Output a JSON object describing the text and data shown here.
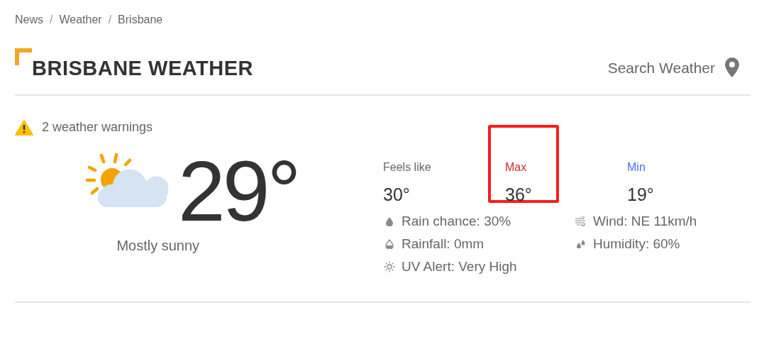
{
  "breadcrumb": [
    {
      "kind": "link",
      "text": "News"
    },
    {
      "kind": "separator",
      "text": "/"
    },
    {
      "kind": "link",
      "text": "Weather"
    },
    {
      "kind": "separator",
      "text": "/"
    },
    {
      "kind": "link",
      "text": "Brisbane"
    }
  ],
  "title": "BRISBANE WEATHER",
  "search": {
    "label": "Search Weather"
  },
  "warnings": {
    "text": "2 weather warnings"
  },
  "current": {
    "temperature": "29°",
    "condition": "Mostly sunny"
  },
  "stats": [
    {
      "label": "Feels like",
      "value": "30°",
      "color": "#666666",
      "highlighted": false
    },
    {
      "label": "Max",
      "value": "36°",
      "color": "#c8302c",
      "highlighted": true
    },
    {
      "label": "Min",
      "value": "19°",
      "color": "#4a6cf0",
      "highlighted": false
    }
  ],
  "details_left": [
    {
      "kind": "rain-chance",
      "text": "Rain chance: 30%"
    },
    {
      "kind": "rainfall",
      "text": "Rainfall: 0mm"
    },
    {
      "kind": "uv",
      "text": "UV Alert: Very High"
    }
  ],
  "details_right": [
    {
      "kind": "wind",
      "text": "Wind: NE 11km/h"
    },
    {
      "kind": "humidity",
      "text": "Humidity: 60%"
    }
  ]
}
